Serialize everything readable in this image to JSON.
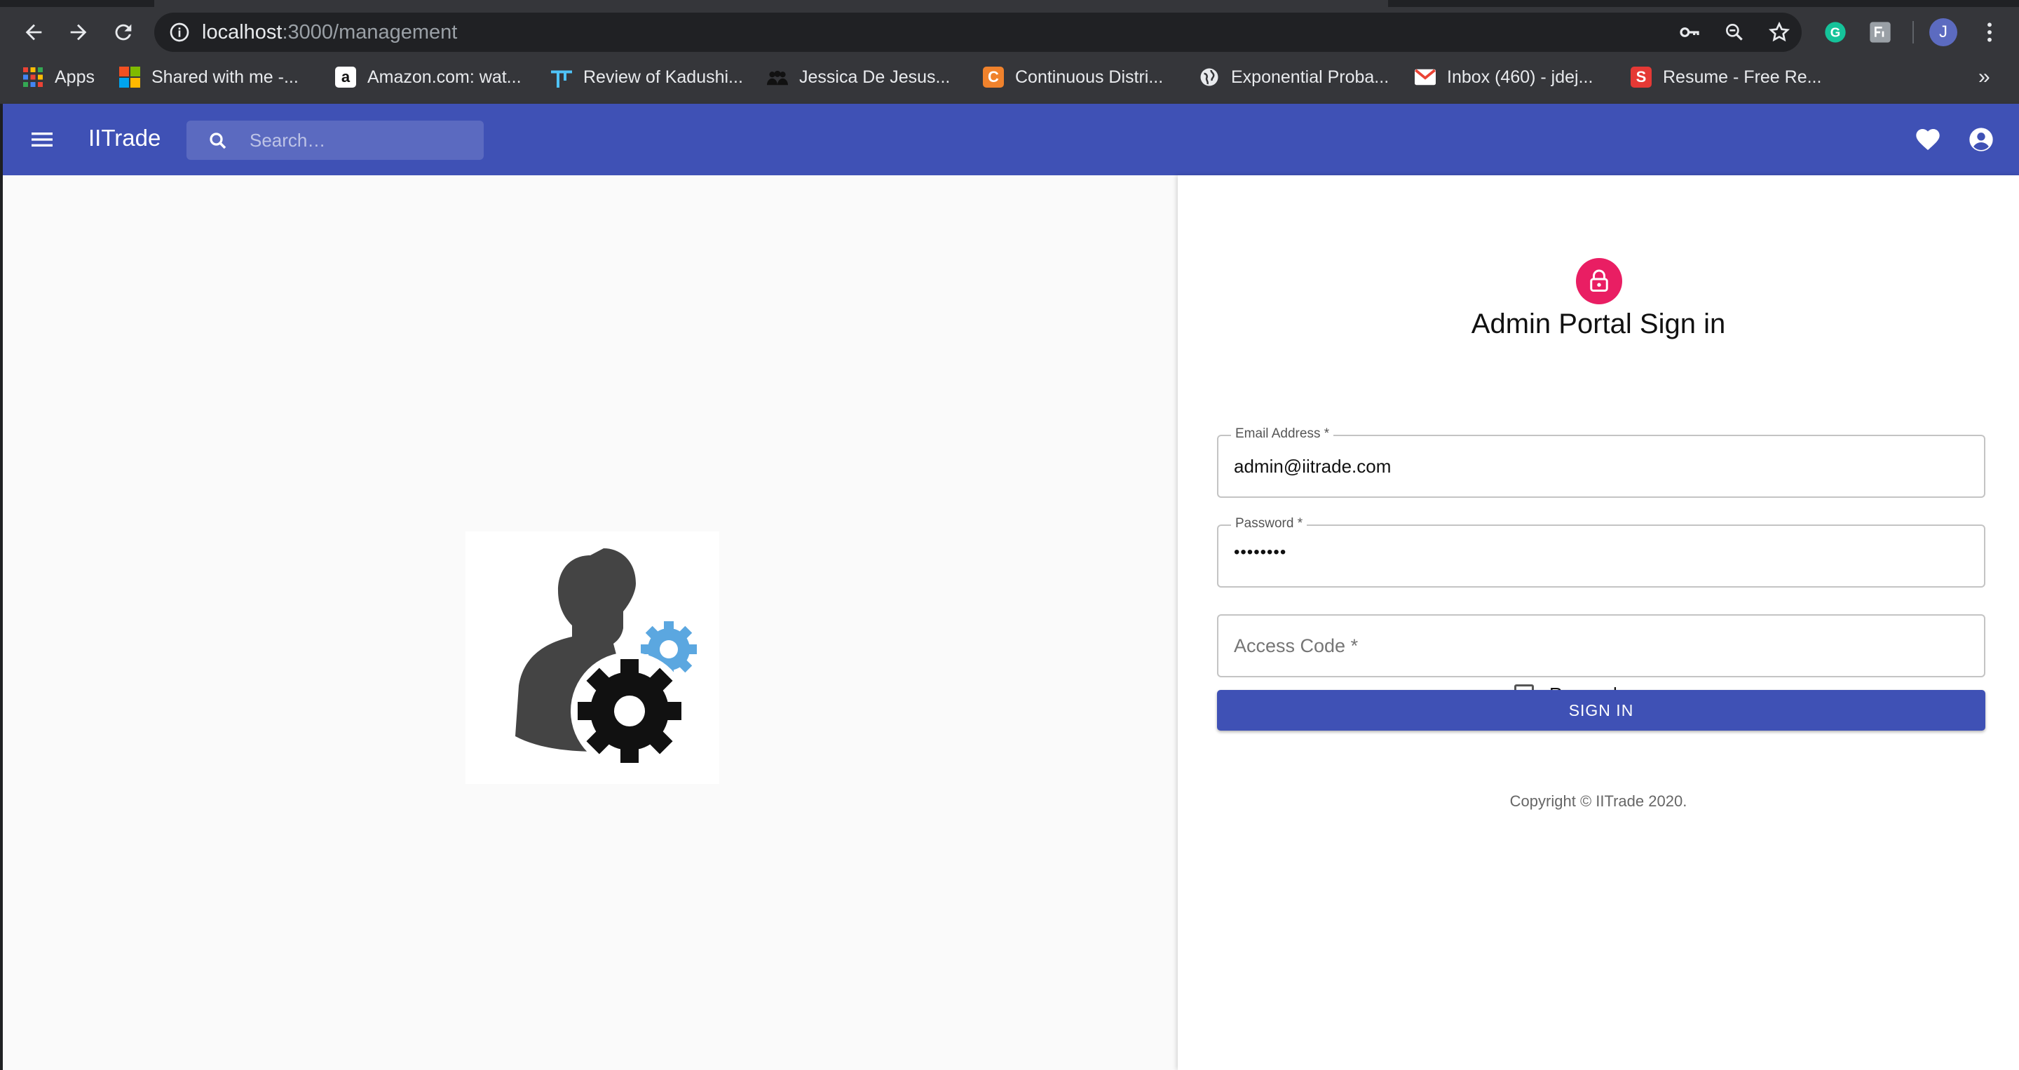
{
  "browser": {
    "url_host": "localhost",
    "url_path": ":3000/management",
    "bookmarks": [
      {
        "label": "Apps",
        "icon": "apps-grid-icon"
      },
      {
        "label": "Shared with me -...",
        "icon": "microsoft-icon"
      },
      {
        "label": "Amazon.com: wat...",
        "icon": "amazon-icon"
      },
      {
        "label": "Review of Kadushi...",
        "icon": "review-icon"
      },
      {
        "label": "Jessica De Jesus...",
        "icon": "people-icon"
      },
      {
        "label": "Continuous Distri...",
        "icon": "c-icon"
      },
      {
        "label": "Exponential Proba...",
        "icon": "globe-icon"
      },
      {
        "label": "Inbox (460) - jdej...",
        "icon": "gmail-icon"
      },
      {
        "label": "Resume - Free Re...",
        "icon": "s-icon"
      }
    ],
    "more_label": "»",
    "profile_initial": "J"
  },
  "appbar": {
    "brand": "IITrade",
    "search_placeholder": "Search…"
  },
  "form": {
    "title": "Admin Portal Sign in",
    "email_label": "Email Address *",
    "email_value": "admin@iitrade.com",
    "password_label": "Password *",
    "password_value": "••••••••",
    "access_code_placeholder": "Access Code *",
    "remember_label": "Remember me",
    "signin_label": "SIGN IN",
    "copyright": "Copyright © IITrade 2020."
  },
  "colors": {
    "primary": "#3f51b5",
    "secondary": "#e91e63"
  }
}
